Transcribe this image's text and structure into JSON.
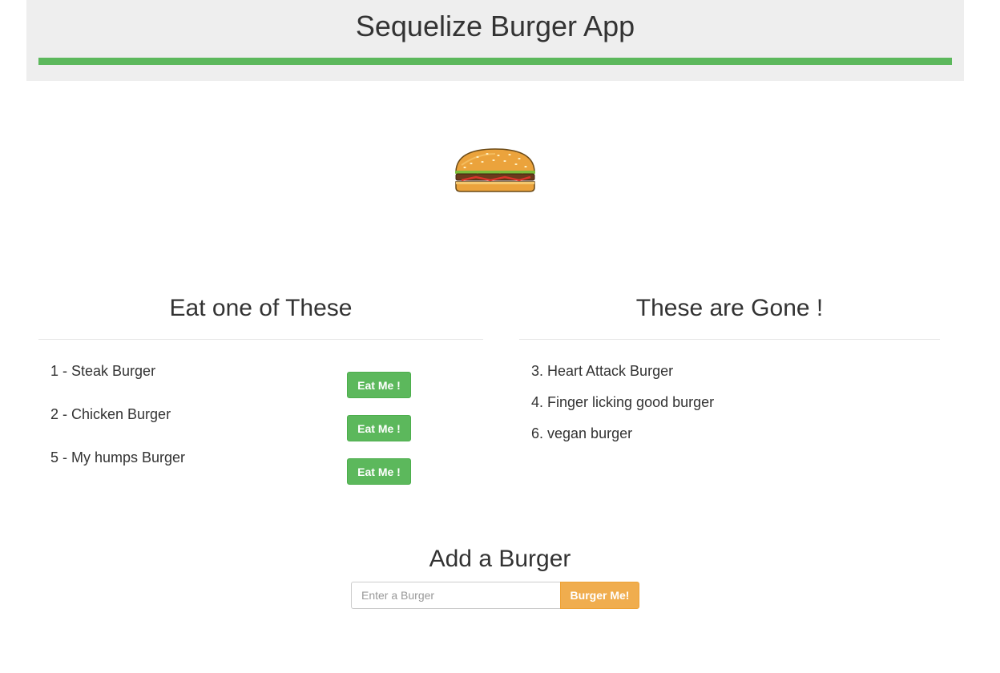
{
  "header": {
    "title": "Sequelize Burger App",
    "accent_color": "#5cb85c"
  },
  "logo": {
    "icon": "hamburger-icon"
  },
  "uneaten": {
    "title": "Eat one of These",
    "items": [
      {
        "label": "1 - Steak Burger",
        "button": "Eat Me !"
      },
      {
        "label": "2 - Chicken Burger",
        "button": "Eat Me !"
      },
      {
        "label": "5 - My humps Burger",
        "button": "Eat Me !"
      }
    ]
  },
  "devoured": {
    "title": "These are Gone !",
    "items": [
      {
        "label": "3. Heart Attack Burger"
      },
      {
        "label": "4. Finger licking good burger"
      },
      {
        "label": "6. vegan burger"
      }
    ]
  },
  "add": {
    "title": "Add a Burger",
    "placeholder": "Enter a Burger",
    "value": "",
    "button": "Burger Me!",
    "button_color": "#f0ad4e"
  }
}
